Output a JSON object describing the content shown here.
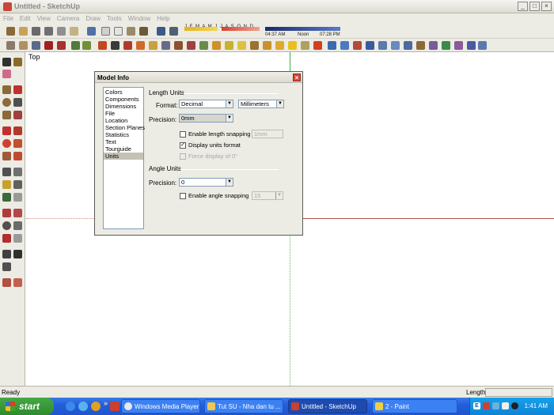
{
  "window": {
    "title": "Untitled - SketchUp",
    "controls": [
      "_",
      "□",
      "×"
    ]
  },
  "menu": [
    "File",
    "Edit",
    "View",
    "Camera",
    "Draw",
    "Tools",
    "Window",
    "Help"
  ],
  "shadow_toolbar": {
    "months": "J F M A M J J A S O N D",
    "time_start": "04:37 AM",
    "time_noon": "Noon",
    "time_end": "07:28 PM"
  },
  "viewport": {
    "view_label": "Top"
  },
  "dialog": {
    "title": "Model Info",
    "categories": [
      "Colors",
      "Components",
      "Dimensions",
      "File",
      "Location",
      "Section Planes",
      "Statistics",
      "Text",
      "Tourguide",
      "Units"
    ],
    "selected_category": "Units",
    "length_units": {
      "heading": "Length Units",
      "format_label": "Format:",
      "format_value": "Decimal",
      "unit_value": "Millimeters",
      "precision_label": "Precision:",
      "precision_value": "0mm",
      "enable_snapping_label": "Enable length snapping",
      "enable_snapping_checked": false,
      "snapping_value": "1mm",
      "display_format_label": "Display units format",
      "display_format_checked": true,
      "force_display_label": "Force display of 0\"",
      "force_display_checked": false
    },
    "angle_units": {
      "heading": "Angle Units",
      "precision_label": "Precision:",
      "precision_value": "0",
      "enable_snapping_label": "Enable angle snapping",
      "enable_snapping_checked": false,
      "snapping_value": "15"
    }
  },
  "statusbar": {
    "status": "Ready",
    "length_label": "Length"
  },
  "taskbar": {
    "start_label": "start",
    "tasks": [
      "Windows Media Player",
      "Tut SU - Nha dan tu ...",
      "Untitled - SketchUp",
      "2 - Paint"
    ],
    "active_task": "Untitled - SketchUp",
    "clock": "1:41 AM",
    "tray_lang": "E"
  },
  "colors": {
    "titlebar_bg": "#dedcd2",
    "taskbar_blue": "#245edc",
    "start_green": "#2e8a2e",
    "axis_red": "#b0504a",
    "axis_green": "#3db03d",
    "dialog_close": "#d64a38"
  }
}
